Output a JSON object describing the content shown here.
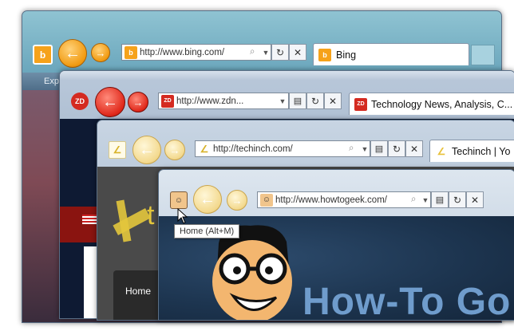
{
  "desktop": {
    "theme": "windows-aero-teal"
  },
  "windows": [
    {
      "site": "bing",
      "url": "http://www.bing.com/",
      "tab_title": "Bing",
      "menu_items": [
        "Explo"
      ],
      "favicon": "b",
      "favicon_color": "#f6a21a"
    },
    {
      "site": "zdnet",
      "url": "http://www.zdn...",
      "tab_title": "Technology News, Analysis, C...",
      "favicon": "ZD",
      "favicon_color": "#d42a20"
    },
    {
      "site": "techinch",
      "url": "http://techinch.com/",
      "tab_title": "Techinch | Yo",
      "logo_text": "t",
      "nav_home": "Home",
      "favicon_color": "#e8c13a"
    },
    {
      "site": "howtogeek",
      "url": "http://www.howtogeek.com/",
      "banner_text": "How-To Go",
      "favicon_color": "#f1c58c"
    }
  ],
  "tooltip": {
    "text": "Home (Alt+M)"
  },
  "icons": {
    "back": "left-arrow-icon",
    "forward": "right-arrow-icon",
    "search": "magnifier-icon",
    "dropdown": "chevron-down-icon",
    "compat": "compatibility-view-icon",
    "refresh": "refresh-icon",
    "stop": "close-icon"
  },
  "colors": {
    "bing_orange": "#f19a10",
    "zdnet_red": "#e0281a",
    "techinch_red": "#b4140f",
    "htg_navy": "#1d3550",
    "htg_text_blue": "#6f9ccc"
  }
}
